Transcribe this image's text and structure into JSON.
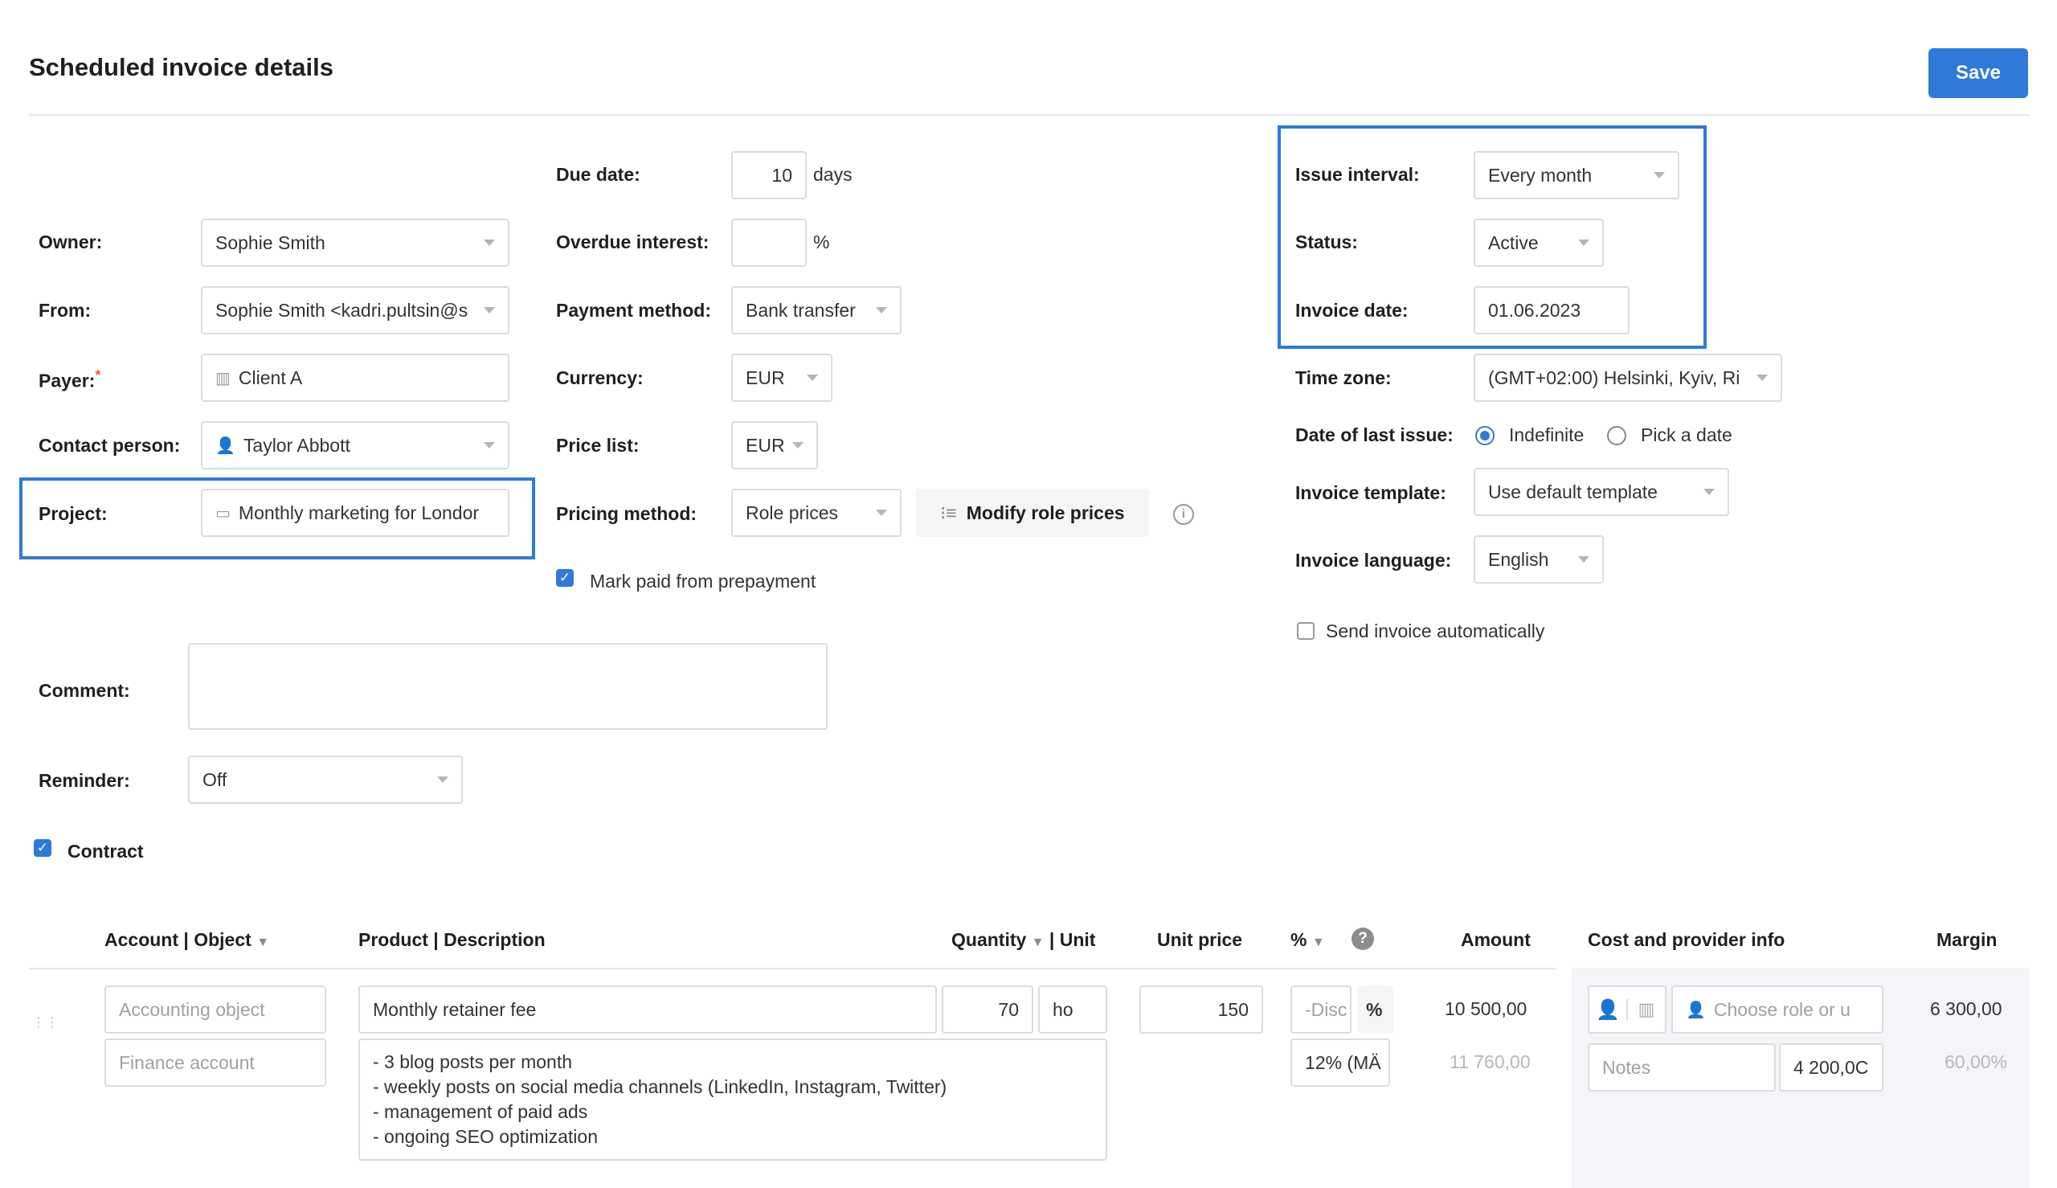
{
  "header": {
    "title": "Scheduled invoice details",
    "save_label": "Save"
  },
  "left": {
    "owner_label": "Owner:",
    "owner_value": "Sophie Smith",
    "from_label": "From:",
    "from_value": "Sophie Smith <kadri.pultsin@s",
    "payer_label": "Payer:",
    "payer_required": "*",
    "payer_value": "Client A",
    "contact_label": "Contact person:",
    "contact_value": "Taylor Abbott",
    "project_label": "Project:",
    "project_value": "Monthly marketing for Londor",
    "comment_label": "Comment:",
    "comment_value": "",
    "reminder_label": "Reminder:",
    "reminder_value": "Off",
    "contract_label": "Contract"
  },
  "middle": {
    "due_label": "Due date:",
    "due_value": "10",
    "due_unit": "days",
    "overdue_label": "Overdue interest:",
    "overdue_value": "",
    "overdue_unit": "%",
    "payment_label": "Payment method:",
    "payment_value": "Bank transfer",
    "currency_label": "Currency:",
    "currency_value": "EUR",
    "pricelist_label": "Price list:",
    "pricelist_value": "EUR",
    "pricing_label": "Pricing method:",
    "pricing_value": "Role prices",
    "modify_label": "Modify role prices",
    "markpaid_label": "Mark paid from prepayment"
  },
  "right": {
    "interval_label": "Issue interval:",
    "interval_value": "Every month",
    "status_label": "Status:",
    "status_value": "Active",
    "invdate_label": "Invoice date:",
    "invdate_value": "01.06.2023",
    "timezone_label": "Time zone:",
    "timezone_value": "(GMT+02:00) Helsinki, Kyiv, Ri",
    "lastissue_label": "Date of last issue:",
    "opt_indefinite": "Indefinite",
    "opt_pick": "Pick a date",
    "template_label": "Invoice template:",
    "template_value": "Use default template",
    "language_label": "Invoice language:",
    "language_value": "English",
    "send_label": "Send invoice automatically"
  },
  "table": {
    "headers": {
      "account": "Account",
      "object": "Object",
      "product": "Product",
      "description": "Description",
      "quantity": "Quantity",
      "unit": "Unit",
      "unit_price": "Unit price",
      "percent": "%",
      "amount": "Amount",
      "cost": "Cost and provider info",
      "margin": "Margin"
    },
    "row": {
      "account_placeholder": "Accounting object",
      "finance_placeholder": "Finance account",
      "product": "Monthly retainer fee",
      "quantity": "70",
      "unit": "ho",
      "unit_price": "150",
      "discount_placeholder": "-Disc",
      "percent_sym": "%",
      "vat": "12% (MÄ",
      "amount": "10 500,00",
      "amount_vat": "11 760,00",
      "description": "- 3 blog posts per month\n- weekly posts on social media channels (LinkedIn, Instagram, Twitter)\n- management of paid ads\n- ongoing SEO optimization",
      "role_placeholder": "Choose role or u",
      "notes_placeholder": "Notes",
      "cost": "4 200,0C",
      "margin": "6 300,00",
      "margin_pct": "60,00%"
    }
  },
  "colors": {
    "accent": "#2f7ad9",
    "border": "#dcdcdc"
  }
}
